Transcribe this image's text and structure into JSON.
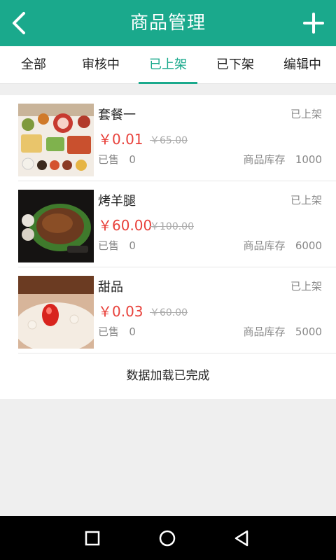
{
  "header": {
    "title": "商品管理",
    "back_icon": "chevron-left-icon",
    "add_icon": "plus-icon"
  },
  "tabs": [
    {
      "label": "全部",
      "active": false
    },
    {
      "label": "审核中",
      "active": false
    },
    {
      "label": "已上架",
      "active": true
    },
    {
      "label": "已下架",
      "active": false
    },
    {
      "label": "编辑中",
      "active": false
    }
  ],
  "products": [
    {
      "name": "套餐一",
      "status": "已上架",
      "price": "￥0.01",
      "original_price": "￥65.00",
      "sold_label": "已售",
      "sold": "0",
      "stock_label": "商品库存",
      "stock": "1000"
    },
    {
      "name": "烤羊腿",
      "status": "已上架",
      "price": "￥60.00",
      "original_price": "￥100.00",
      "sold_label": "已售",
      "sold": "0",
      "stock_label": "商品库存",
      "stock": "6000"
    },
    {
      "name": "甜品",
      "status": "已上架",
      "price": "￥0.03",
      "original_price": "￥60.00",
      "sold_label": "已售",
      "sold": "0",
      "stock_label": "商品库存",
      "stock": "5000"
    }
  ],
  "list_footer": "数据加载已完成",
  "system_nav": {
    "recent_icon": "square-icon",
    "home_icon": "circle-icon",
    "back_icon": "triangle-back-icon"
  },
  "colors": {
    "accent": "#1aa98c",
    "price": "#e8413b",
    "muted": "#888888"
  }
}
